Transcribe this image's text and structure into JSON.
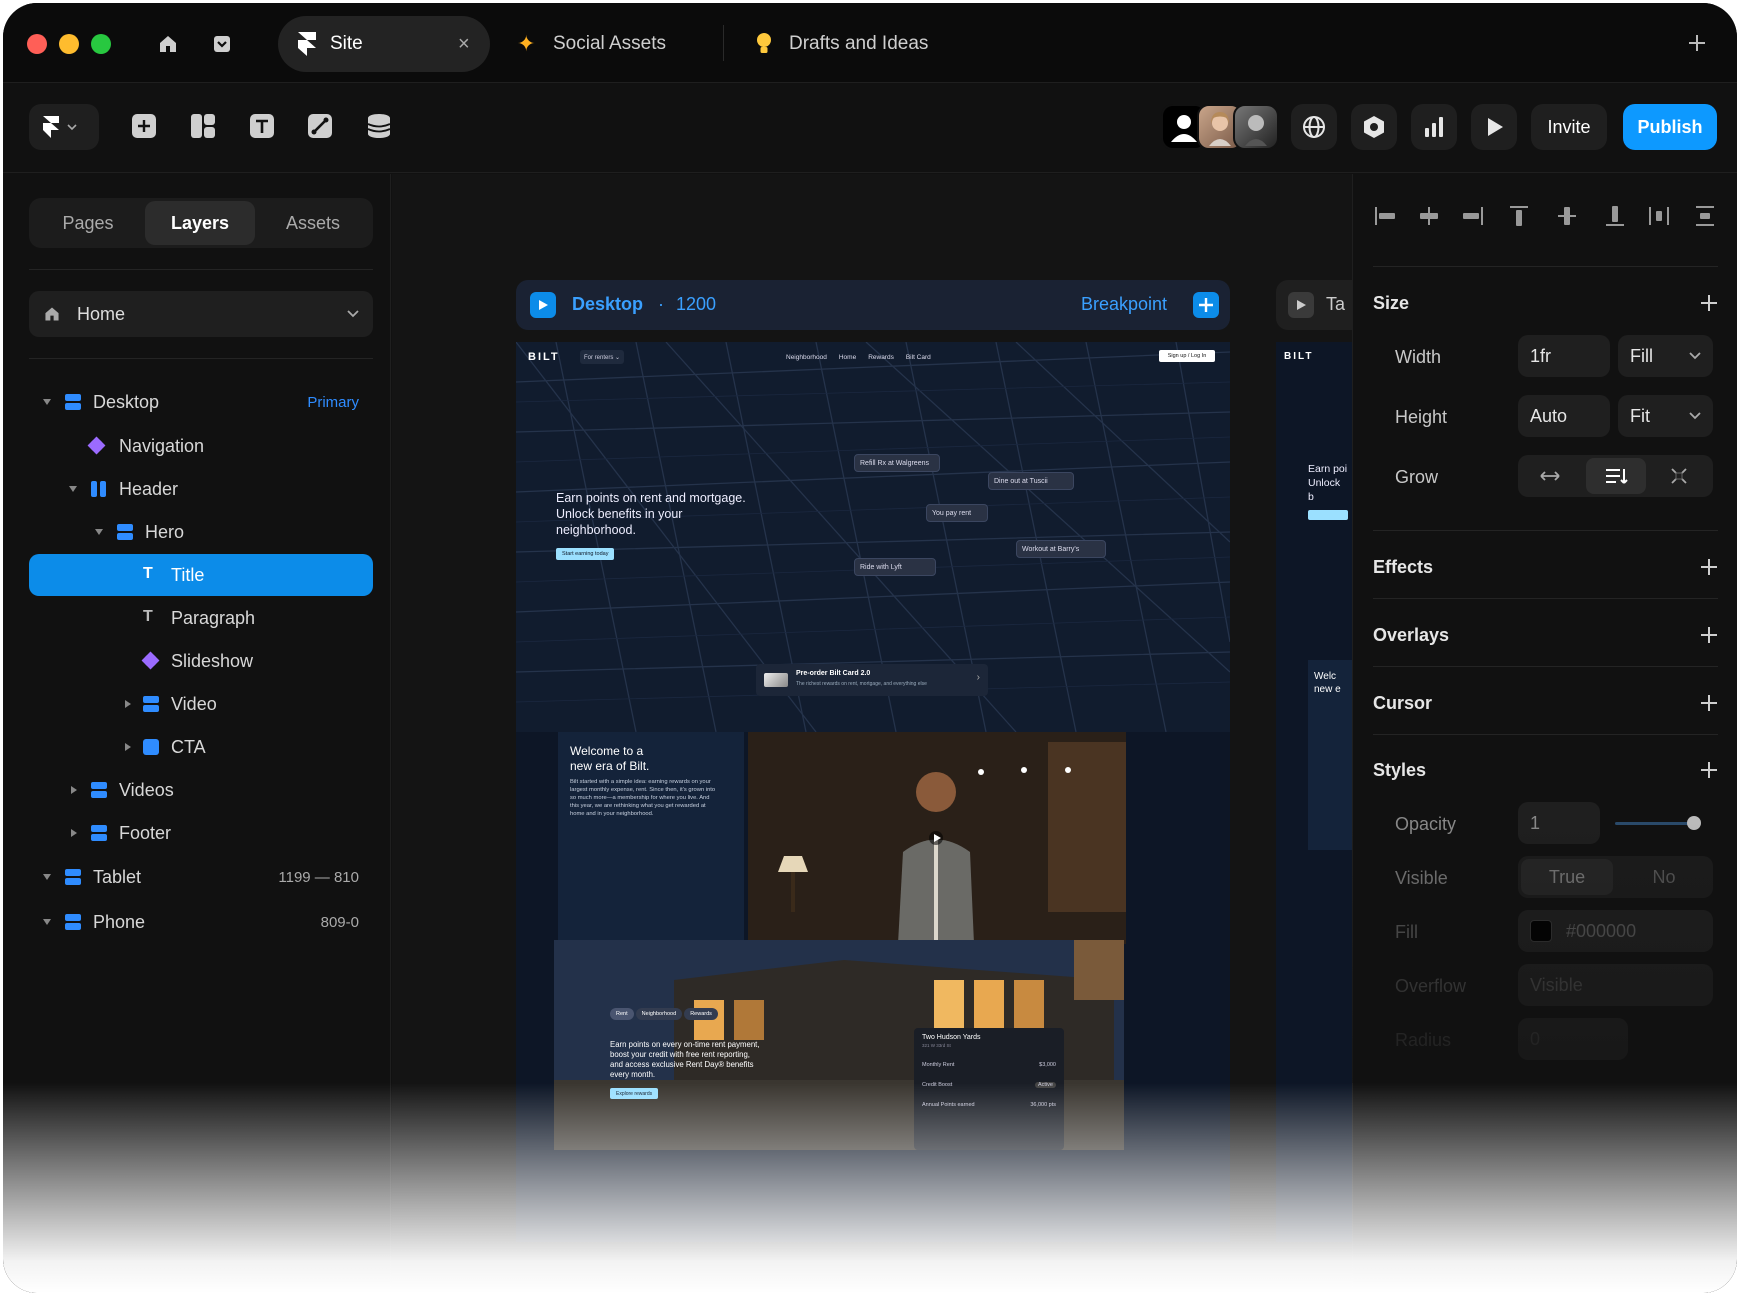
{
  "tabs": [
    {
      "label": "Site",
      "active": true
    },
    {
      "label": "Social Assets"
    },
    {
      "label": "Drafts and Ideas"
    }
  ],
  "toolbar": {
    "invite_label": "Invite",
    "publish_label": "Publish"
  },
  "left": {
    "segments": [
      "Pages",
      "Layers",
      "Assets"
    ],
    "page_select": "Home",
    "layers": [
      {
        "label": "Desktop",
        "meta": "Primary"
      },
      {
        "label": "Navigation"
      },
      {
        "label": "Header"
      },
      {
        "label": "Hero"
      },
      {
        "label": "Title"
      },
      {
        "label": "Paragraph"
      },
      {
        "label": "Slideshow"
      },
      {
        "label": "Video"
      },
      {
        "label": "CTA"
      },
      {
        "label": "Videos"
      },
      {
        "label": "Footer"
      },
      {
        "label": "Tablet",
        "meta": "1199 — 810"
      },
      {
        "label": "Phone",
        "meta": "809-0"
      }
    ]
  },
  "canvas": {
    "frame_title": "Desktop",
    "frame_sep": "·",
    "frame_width": "1200",
    "breakpoint_label": "Breakpoint",
    "tablet_partial": "Ta",
    "site": {
      "logo": "BILT",
      "for_renters": "For renters ⌄",
      "nav": [
        "Neighborhood",
        "Home",
        "Rewards",
        "Bilt Card"
      ],
      "signup": "Sign up / Log In",
      "hero_text": "Earn points on rent and mortgage. Unlock benefits in your neighborhood.",
      "hero_cta": "Start earning today",
      "map_chips": [
        {
          "title": "Refill Rx at Walgreens",
          "sub": "◎ 100 pts"
        },
        {
          "title": "Dine out at Tuscii",
          "sub": "◎ 1000 pts & $10 credit"
        },
        {
          "title": "You pay rent",
          "sub": "◎ 2500 pts"
        },
        {
          "title": "Workout at Barry's",
          "sub": "✓ Complimentary shake"
        },
        {
          "title": "Ride with Lyft",
          "sub": "◎ Redeemed 2000 pts"
        }
      ],
      "preorder_title": "Pre-order Bilt Card 2.0",
      "preorder_sub": "The richest rewards on rent, mortgage, and everything else",
      "welcome_title": "Welcome to a new era of Bilt.",
      "welcome_body": "Bilt started with a simple idea: earning rewards on your largest monthly expense, rent. Since then, it's grown into so much more—a membership for where you live. And this year, we are rethinking what you get rewarded at home and in your neighborhood.",
      "bottom_tabs": [
        "Rent",
        "Neighborhood",
        "Rewards"
      ],
      "bottom_text": "Earn points on every on-time rent payment, boost your credit with free rent reporting, and access exclusive Rent Day® benefits every month.",
      "bottom_cta": "Explore rewards",
      "card_title": "Two Hudson Yards",
      "card_sub": "321 W 33rd St",
      "card_rows": [
        {
          "k": "Monthly Rent",
          "v": "$3,000"
        },
        {
          "k": "Credit Boost",
          "v": "Active"
        },
        {
          "k": "Annual Points earned",
          "v": "36,000 pts"
        }
      ],
      "tablet_hero": "Earn poi Unlock b neighbo",
      "tablet_welcome": "Welc new e"
    }
  },
  "right": {
    "size_label": "Size",
    "width_label": "Width",
    "width_value": "1fr",
    "width_mode": "Fill",
    "height_label": "Height",
    "height_value": "Auto",
    "height_mode": "Fit",
    "grow_label": "Grow",
    "effects": "Effects",
    "overlays": "Overlays",
    "cursor": "Cursor",
    "styles": "Styles",
    "opacity_label": "Opacity",
    "opacity_value": "1",
    "visible_label": "Visible",
    "visible_true": "True",
    "visible_no": "No",
    "fill_label": "Fill",
    "fill_value": "#000000",
    "overflow_label": "Overflow",
    "overflow_value": "Visible",
    "radius_label": "Radius",
    "radius_value": "0"
  },
  "colors": {
    "accent": "#0c8ce9",
    "publish": "#0d99ff",
    "bg": "#111111"
  }
}
